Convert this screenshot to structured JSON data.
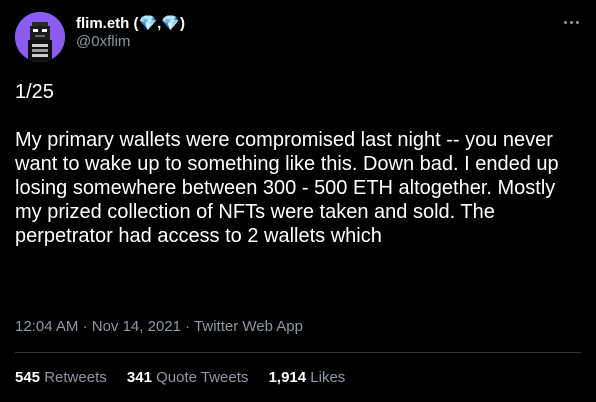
{
  "author": {
    "display_name": "flim.eth (💎,💎)",
    "handle": "@0xflim"
  },
  "tweet": {
    "text": "1/25\n\nMy primary wallets were compromised last night -- you never want to wake up to something like this. Down bad. I ended up losing somewhere between 300 - 500 ETH altogether. Mostly my prized collection of NFTs were taken and sold. The perpetrator had access to 2 wallets which",
    "time": "12:04 AM",
    "date": "Nov 14, 2021",
    "source": "Twitter Web App"
  },
  "stats": {
    "retweets": {
      "count": "545",
      "label": "Retweets"
    },
    "quotes": {
      "count": "341",
      "label": "Quote Tweets"
    },
    "likes": {
      "count": "1,914",
      "label": "Likes"
    }
  },
  "colors": {
    "background": "#000000",
    "text": "#ffffff",
    "secondary": "#8b98a5",
    "avatar_bg": "#8a5cf0"
  },
  "icons": {
    "more": "more-horizontal-icon",
    "avatar": "pixel-punk-avatar"
  }
}
